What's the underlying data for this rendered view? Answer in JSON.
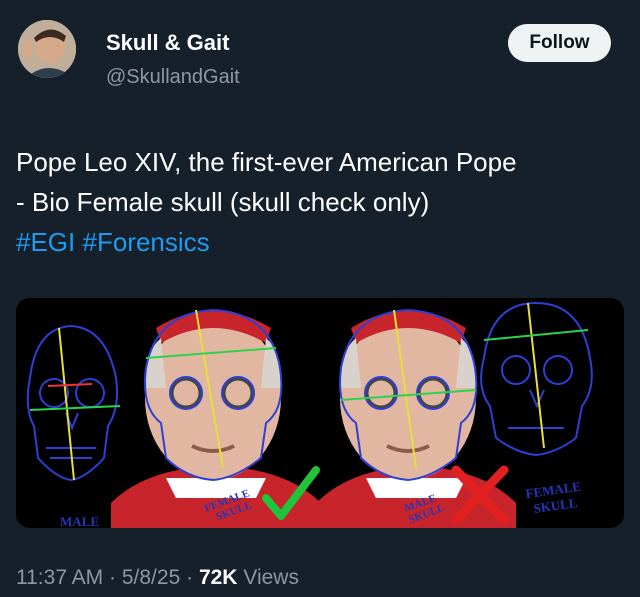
{
  "author": {
    "display_name": "Skull & Gait",
    "handle": "@SkullandGait"
  },
  "follow_button": {
    "label": "Follow"
  },
  "tweet": {
    "line1": "Pope Leo XIV, the first-ever American Pope",
    "line2": "- Bio Female skull (skull check only)",
    "hashtags": [
      "#EGI",
      "#Forensics"
    ]
  },
  "media": {
    "labels": {
      "male": "MALE",
      "female_center": "FEMALE\nSKULL",
      "male_center": "MALE\nSKULL",
      "female_right_1": "FEMALE",
      "female_right_2": "SKULL"
    }
  },
  "meta": {
    "time": "11:37 AM",
    "separator": "·",
    "date": "5/8/25",
    "views_count": "72K",
    "views_label": "Views"
  },
  "colors": {
    "background": "#15202b",
    "hashtag": "#1d9bf0",
    "secondary_text": "#8b98a5",
    "follow_button_bg": "#eff3f4"
  }
}
